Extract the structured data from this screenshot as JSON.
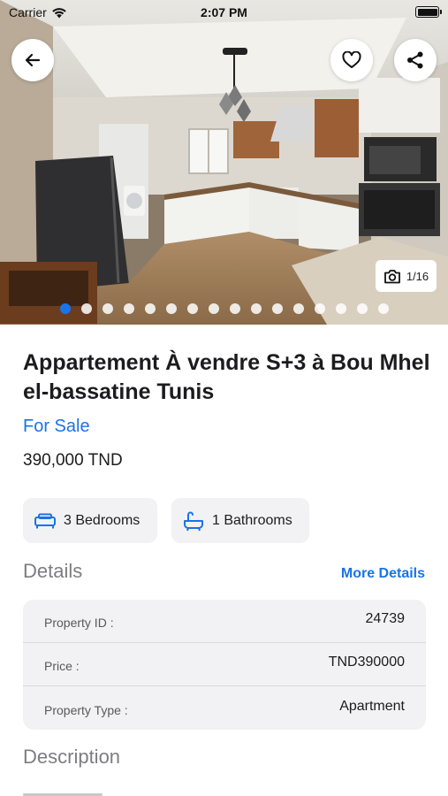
{
  "status_bar": {
    "carrier": "Carrier",
    "time": "2:07 PM"
  },
  "gallery": {
    "counter": "1/16",
    "total_dots": 16,
    "active_dot": 1
  },
  "listing": {
    "title": "Appartement À vendre S+3 à Bou Mhel el-bassatine Tunis",
    "status": "For Sale",
    "price": "390,000 TND"
  },
  "features": {
    "bedrooms": "3 Bedrooms",
    "bathrooms": "1 Bathrooms"
  },
  "details": {
    "heading": "Details",
    "more_link": "More Details",
    "rows": [
      {
        "label": "Property ID :",
        "value": "24739"
      },
      {
        "label": "Price :",
        "value": "TND390000"
      },
      {
        "label": "Property Type :",
        "value": "Apartment"
      }
    ]
  },
  "description": {
    "heading": "Description"
  },
  "colors": {
    "accent": "#1a73e8",
    "card_bg": "#f2f2f4",
    "muted_text": "#7d7d82"
  },
  "icons": {
    "back": "arrow-left-icon",
    "favorite": "heart-icon",
    "share": "share-icon",
    "camera": "camera-icon",
    "bed": "bed-icon",
    "bath": "bathtub-icon",
    "wifi": "wifi-icon",
    "battery": "battery-icon"
  }
}
